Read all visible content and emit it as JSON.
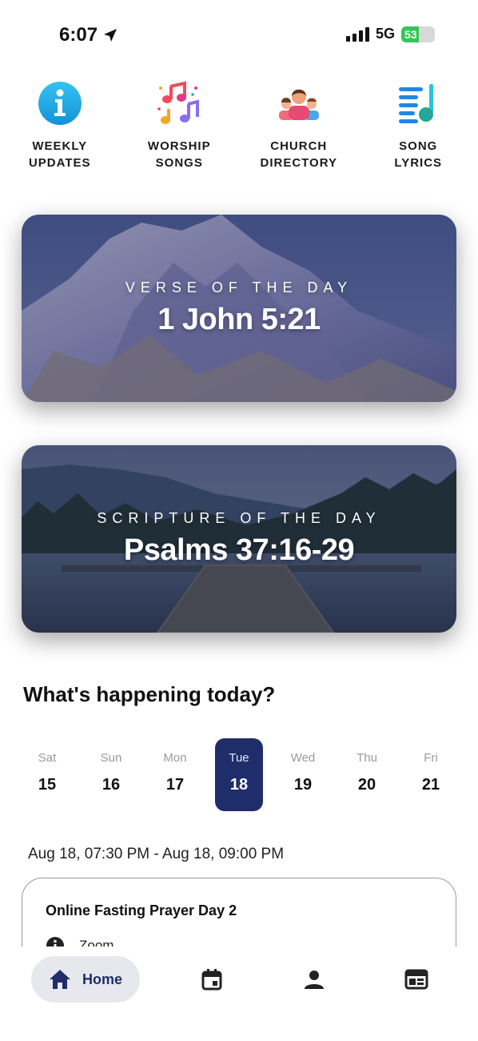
{
  "status_bar": {
    "time": "6:07",
    "network": "5G",
    "battery": "53",
    "battery_level": 0.53
  },
  "quick_actions": [
    {
      "line1": "WEEKLY",
      "line2": "UPDATES",
      "icon": "info-icon"
    },
    {
      "line1": "WORSHIP",
      "line2": "SONGS",
      "icon": "music-notes-icon"
    },
    {
      "line1": "CHURCH",
      "line2": "DIRECTORY",
      "icon": "people-icon"
    },
    {
      "line1": "SONG",
      "line2": "LYRICS",
      "icon": "lyrics-icon"
    }
  ],
  "verse_card": {
    "kicker": "VERSE OF THE DAY",
    "title": "1 John 5:21"
  },
  "scripture_card": {
    "kicker": "SCRIPTURE OF THE DAY",
    "title": "Psalms 37:16-29"
  },
  "section_title": "What's happening today?",
  "days": [
    {
      "name": "Sat",
      "num": "15",
      "selected": false
    },
    {
      "name": "Sun",
      "num": "16",
      "selected": false
    },
    {
      "name": "Mon",
      "num": "17",
      "selected": false
    },
    {
      "name": "Tue",
      "num": "18",
      "selected": true
    },
    {
      "name": "Wed",
      "num": "19",
      "selected": false
    },
    {
      "name": "Thu",
      "num": "20",
      "selected": false
    },
    {
      "name": "Fri",
      "num": "21",
      "selected": false
    }
  ],
  "event": {
    "time_range": "Aug 18, 07:30 PM - Aug 18, 09:00 PM",
    "title": "Online Fasting Prayer Day 2",
    "location": "Zoom"
  },
  "bottom_nav": {
    "home_label": "Home",
    "items": [
      "home-icon",
      "calendar-icon",
      "person-icon",
      "news-icon"
    ]
  },
  "colors": {
    "accent": "#1f2d6b",
    "info_blue": "#1aa7e6",
    "battery_green": "#34c759"
  }
}
